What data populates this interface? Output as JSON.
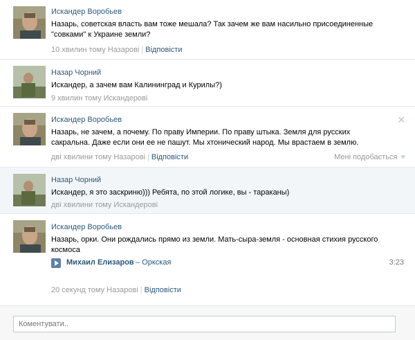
{
  "comments": [
    {
      "author": "Искандер Воробьев",
      "lines": [
        "Назарь, советская власть вам тоже мешала? Так зачем же вам насильно присоединенные",
        "\"совками\" к Украине земли?"
      ],
      "time": "10 хвилин тому Назарові",
      "reply": "Відповісти",
      "avatar": "avatar-iskander"
    },
    {
      "author": "Назар Чорний",
      "lines": [
        "Искандер, а зачем вам Калининград и Курилы?)"
      ],
      "time": "9 хвилин тому Искандерові",
      "reply": "",
      "avatar": "avatar-nazar"
    },
    {
      "author": "Искандер Воробьев",
      "lines": [
        "Назарь, не зачем, а почему. По праву Империи. По праву штыка. Земля для русских",
        "сакральна. Даже если они ее не пашут. Мы хтонический народ. Мы врастаем в землю."
      ],
      "time": "дві хвилини тому Назарові",
      "reply": "Відповісти",
      "likes": "Мені подобається",
      "avatar": "avatar-iskander"
    },
    {
      "author": "Назар Чорний",
      "lines": [
        "Искандер, я это заскриню))) Ребята, по этой логике, вы - тараканы)"
      ],
      "time": "дві хвилини тому Искандерові",
      "reply": "",
      "avatar": "avatar-nazar"
    },
    {
      "author": "Искандер Воробьев",
      "lines": [
        "Назарь, орки. Они рождались прямо из земли. Мать-сыра-земля - основная стихия русского",
        "космоса"
      ],
      "time": "20 секунд тому Назарові",
      "reply": "Відповісти",
      "avatar": "avatar-iskander",
      "audio": {
        "artist": "Михаил Елизаров",
        "title": "– Оркская",
        "duration": "3:23"
      }
    }
  ],
  "compose": {
    "placeholder": "Коментувати.."
  },
  "icons": {
    "close": "close-icon",
    "like": "heart-icon",
    "play": "play-icon"
  },
  "colors": {
    "link": "#2b587a",
    "meta": "#999999",
    "highlight": "#f3f6f9",
    "divider": "#e4e8ed"
  }
}
